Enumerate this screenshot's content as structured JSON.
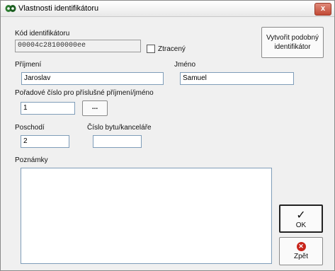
{
  "window": {
    "title": "Vlastnosti identifikátoru",
    "title_icon": "identifier-tag-icon",
    "close_glyph": "x"
  },
  "form": {
    "code_label": "Kód identifikátoru",
    "code_value": "00004c28100000ee",
    "lost_label": "Ztracený",
    "lost_checked": false,
    "create_similar_label": "Vytvořit podobný identifikátor",
    "surname_label": "Příjmení",
    "surname_value": "Jaroslav",
    "name_label": "Jméno",
    "name_value": "Samuel",
    "order_label": "Pořadové číslo pro příslušné příjmení/jméno",
    "order_value": "1",
    "browse_label": "...",
    "floor_label": "Poschodí",
    "floor_value": "2",
    "room_label": "Číslo bytu/kanceláře",
    "room_value": "",
    "notes_label": "Poznámky",
    "notes_value": ""
  },
  "buttons": {
    "ok_label": "OK",
    "ok_icon": "checkmark-icon",
    "back_label": "Zpět",
    "back_icon": "red-x-circle-icon"
  },
  "colors": {
    "close_button": "#c24a36",
    "back_icon": "#c8241a",
    "field_border": "#7f9db9"
  }
}
